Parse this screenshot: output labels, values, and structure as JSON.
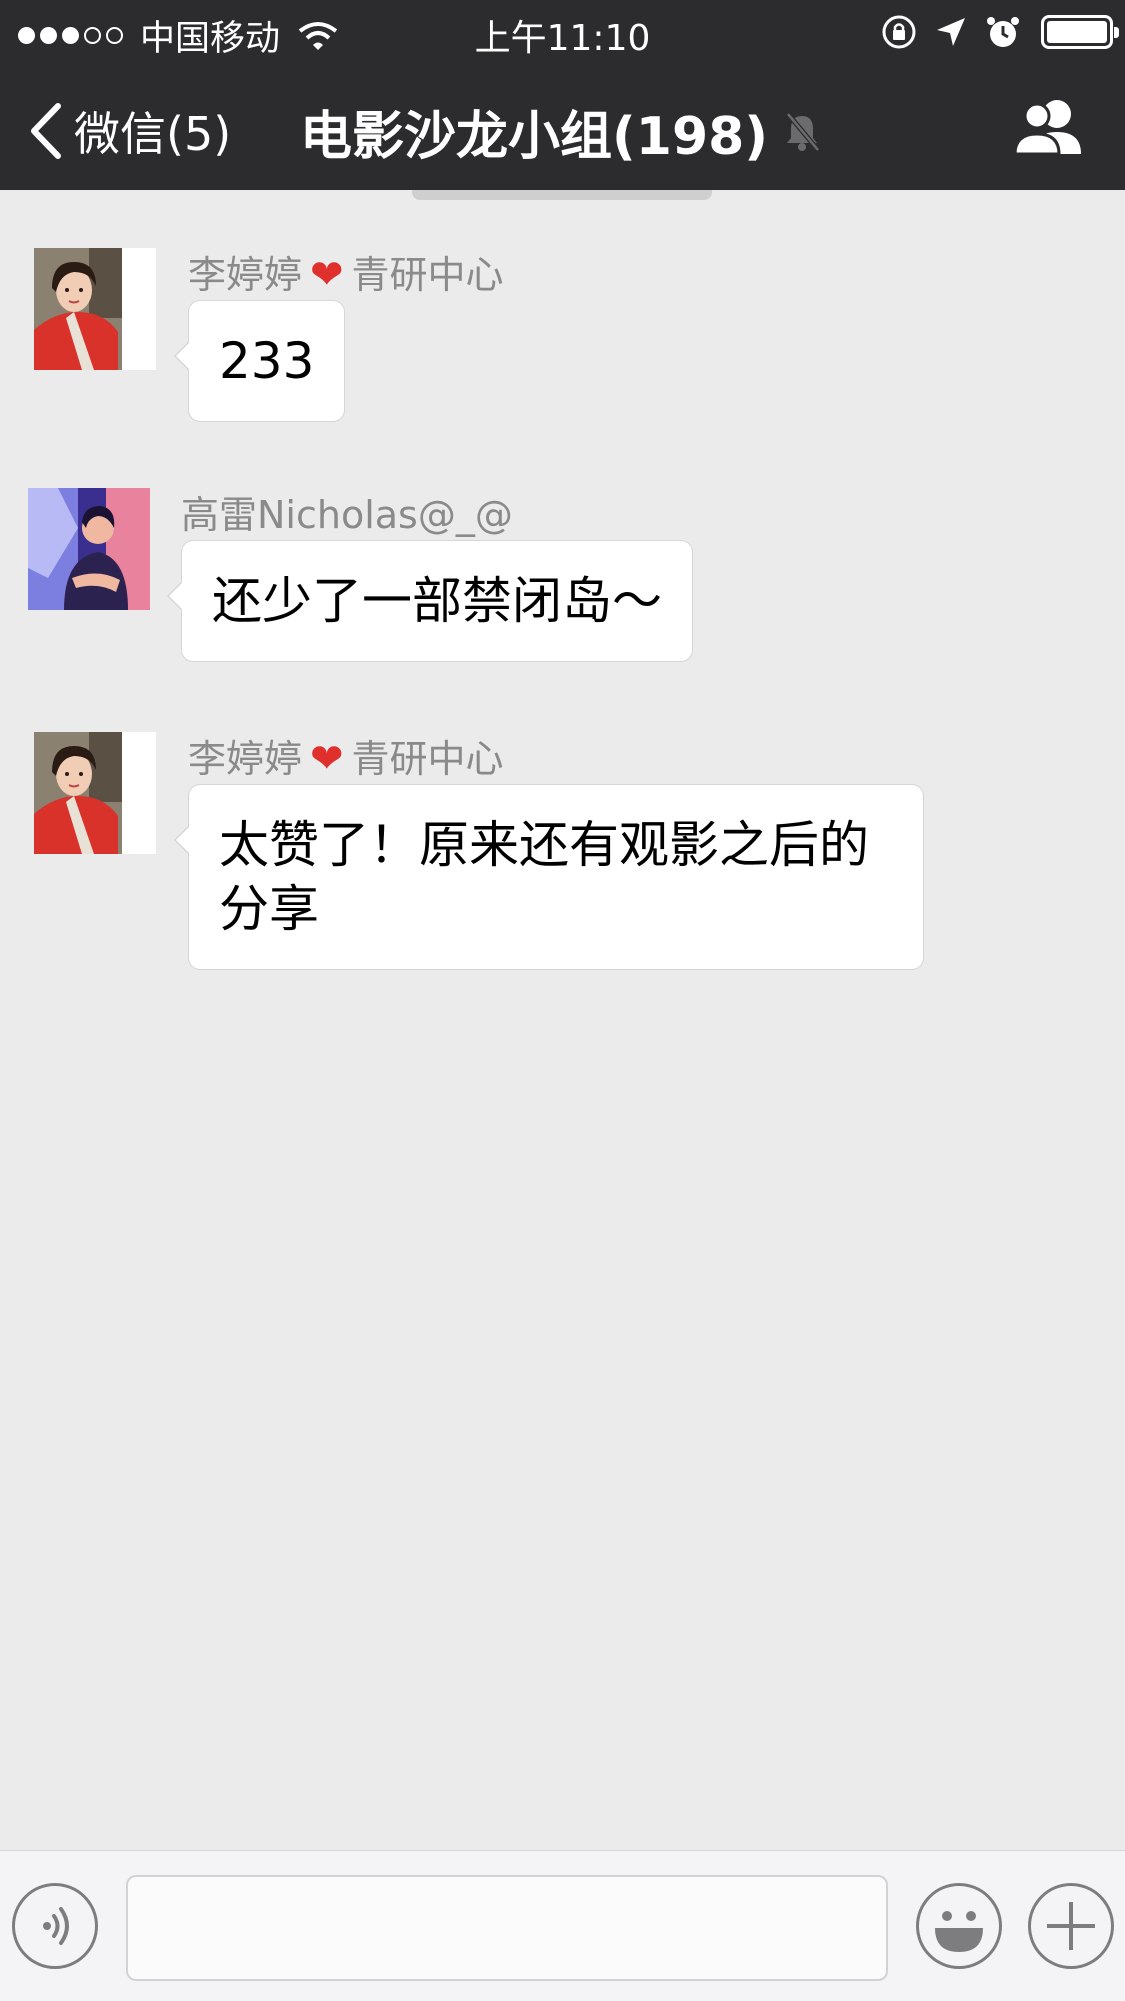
{
  "status_bar": {
    "carrier": "中国移动",
    "time": "上午11:10",
    "signal_bars_filled": 3,
    "signal_bars_total": 5
  },
  "nav": {
    "back_label": "微信(5)",
    "title": "电影沙龙小组(198)"
  },
  "messages": [
    {
      "sender_name": "李婷婷",
      "sender_org": "青研中心",
      "text": "233"
    },
    {
      "sender_name": "高雷Nicholas@_@",
      "text": "还少了一部禁闭岛～"
    },
    {
      "sender_name": "李婷婷",
      "sender_org": "青研中心",
      "text_line1": "太赞了！原来还有观影之后的",
      "text_line2": "分享"
    }
  ],
  "icons": {
    "back": "chevron-left-icon",
    "mute": "bell-muted-icon",
    "members": "group-icon",
    "voice": "voice-icon",
    "emoji": "emoji-icon",
    "more": "plus-icon"
  }
}
